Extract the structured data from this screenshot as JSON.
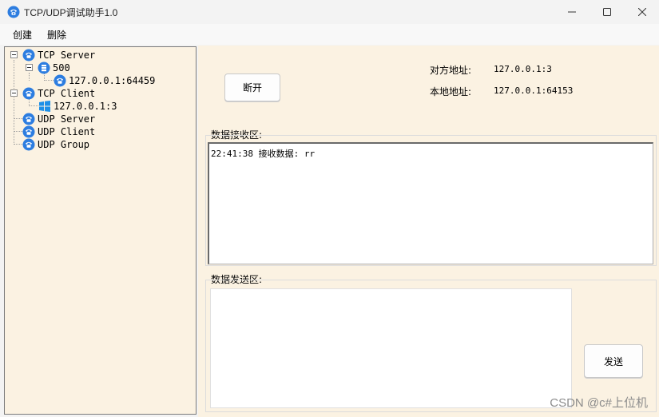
{
  "window": {
    "title": "TCP/UDP调试助手1.0"
  },
  "menu": {
    "items": [
      "创建",
      "删除"
    ]
  },
  "tree": {
    "tcp_server": "TCP Server",
    "port": "500",
    "server_conn": "127.0.0.1:64459",
    "tcp_client": "TCP Client",
    "client_conn": "127.0.0.1:3",
    "udp_server": "UDP Server",
    "udp_client": "UDP Client",
    "udp_group": "UDP Group"
  },
  "connection": {
    "disconnect_label": "断开",
    "remote_label": "对方地址:",
    "remote_value": "127.0.0.1:3",
    "local_label": "本地地址:",
    "local_value": "127.0.0.1:64153"
  },
  "receive": {
    "label": "数据接收区:",
    "lines": [
      "22:41:38 接收数据: rr"
    ]
  },
  "send": {
    "label": "数据发送区:",
    "text": "",
    "button_label": "发送"
  },
  "watermark": "CSDN @c#上位机",
  "colors": {
    "panel_bg": "#fbf2e2",
    "icon_blue": "#2d7de0"
  }
}
